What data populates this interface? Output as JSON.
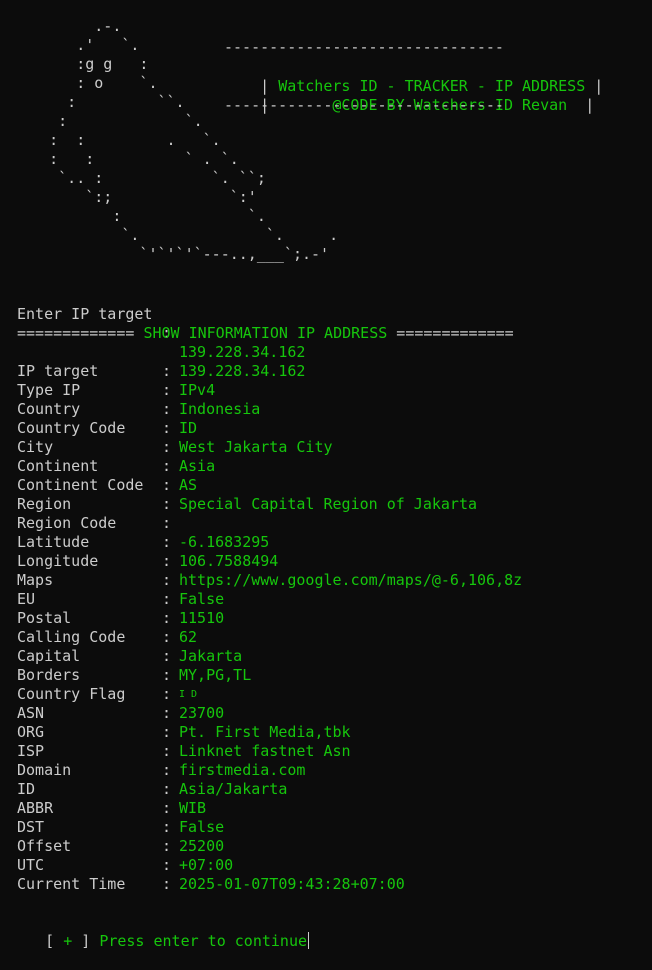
{
  "banner": {
    "rule": "-------------------------------",
    "title": "Watchers ID - TRACKER - IP ADDRESS",
    "credit": "@CODE BY Watchers ID Revan",
    "art": [
      "         .-.",
      "       .'   `.",
      "       :g g   :",
      "       : o    `.",
      "      :         ``.",
      "     :             `.",
      "    :  :         .   `.",
      "    :   :          ` . `.",
      "     `.. :            `. ``;",
      "        `:;             `:'",
      "           :              `.",
      "            `.              `.     .",
      "              `'`'`'`---..,___`;.-'"
    ]
  },
  "prompt": {
    "label": "Enter IP target",
    "sep": ":",
    "value": "139.228.34.162"
  },
  "section_header": "============= SHOW INFORMATION IP ADDRESS =============",
  "info": [
    {
      "label": "IP target",
      "value": "139.228.34.162"
    },
    {
      "label": "Type IP",
      "value": "IPv4"
    },
    {
      "label": "Country",
      "value": "Indonesia"
    },
    {
      "label": "Country Code",
      "value": "ID"
    },
    {
      "label": "City",
      "value": "West Jakarta City"
    },
    {
      "label": "Continent",
      "value": "Asia"
    },
    {
      "label": "Continent Code",
      "value": "AS"
    },
    {
      "label": "Region",
      "value": "Special Capital Region of Jakarta"
    },
    {
      "label": "Region Code",
      "value": ""
    },
    {
      "label": "Latitude",
      "value": "-6.1683295"
    },
    {
      "label": "Longitude",
      "value": "106.7588494"
    },
    {
      "label": "Maps",
      "value": "https://www.google.com/maps/@-6,106,8z"
    },
    {
      "label": "EU",
      "value": "False"
    },
    {
      "label": "Postal",
      "value": "11510"
    },
    {
      "label": "Calling Code",
      "value": "62"
    },
    {
      "label": "Capital",
      "value": "Jakarta"
    },
    {
      "label": "Borders",
      "value": "MY,PG,TL"
    },
    {
      "label": "Country Flag",
      "value": "I D"
    },
    {
      "label": "ASN",
      "value": "23700"
    },
    {
      "label": "ORG",
      "value": "Pt. First Media,tbk"
    },
    {
      "label": "ISP",
      "value": "Linknet fastnet Asn"
    },
    {
      "label": "Domain",
      "value": "firstmedia.com"
    },
    {
      "label": "ID",
      "value": "Asia/Jakarta"
    },
    {
      "label": "ABBR",
      "value": "WIB"
    },
    {
      "label": "DST",
      "value": "False"
    },
    {
      "label": "Offset",
      "value": "25200"
    },
    {
      "label": "UTC",
      "value": "+07:00"
    },
    {
      "label": "Current Time",
      "value": "2025-01-07T09:43:28+07:00"
    }
  ],
  "continue_prompt": {
    "open": "[",
    "plus": "+",
    "close": "]",
    "text": "Press enter to continue"
  },
  "colors": {
    "background": "#0c0c0c",
    "text": "#cccccc",
    "accent": "#16c60c"
  }
}
